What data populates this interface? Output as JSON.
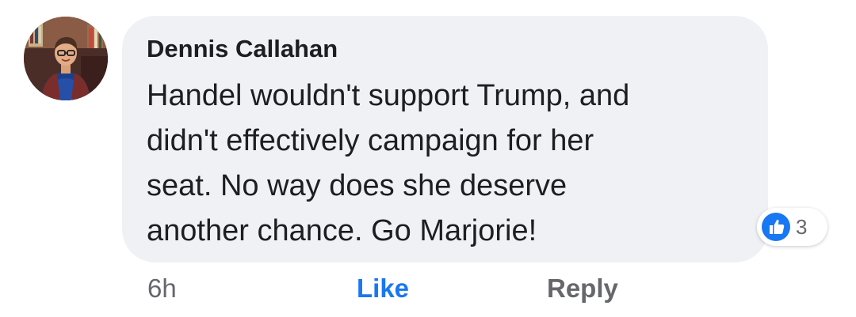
{
  "comment": {
    "author": "Dennis Callahan",
    "text": "Handel wouldn't support Trump, and\ndidn't  effectively campaign for her\nseat. No way does she deserve\nanother chance. Go Marjorie!",
    "avatar_icon": "profile-photo",
    "reactions": {
      "icon": "thumbs-up-icon",
      "count": "3",
      "color": "#1877f2"
    },
    "actions": {
      "timestamp": "6h",
      "like_label": "Like",
      "reply_label": "Reply"
    }
  },
  "colors": {
    "bubble_bg": "#eff1f4",
    "text": "#1c1e21",
    "secondary": "#65676b",
    "accent": "#1877f2"
  }
}
